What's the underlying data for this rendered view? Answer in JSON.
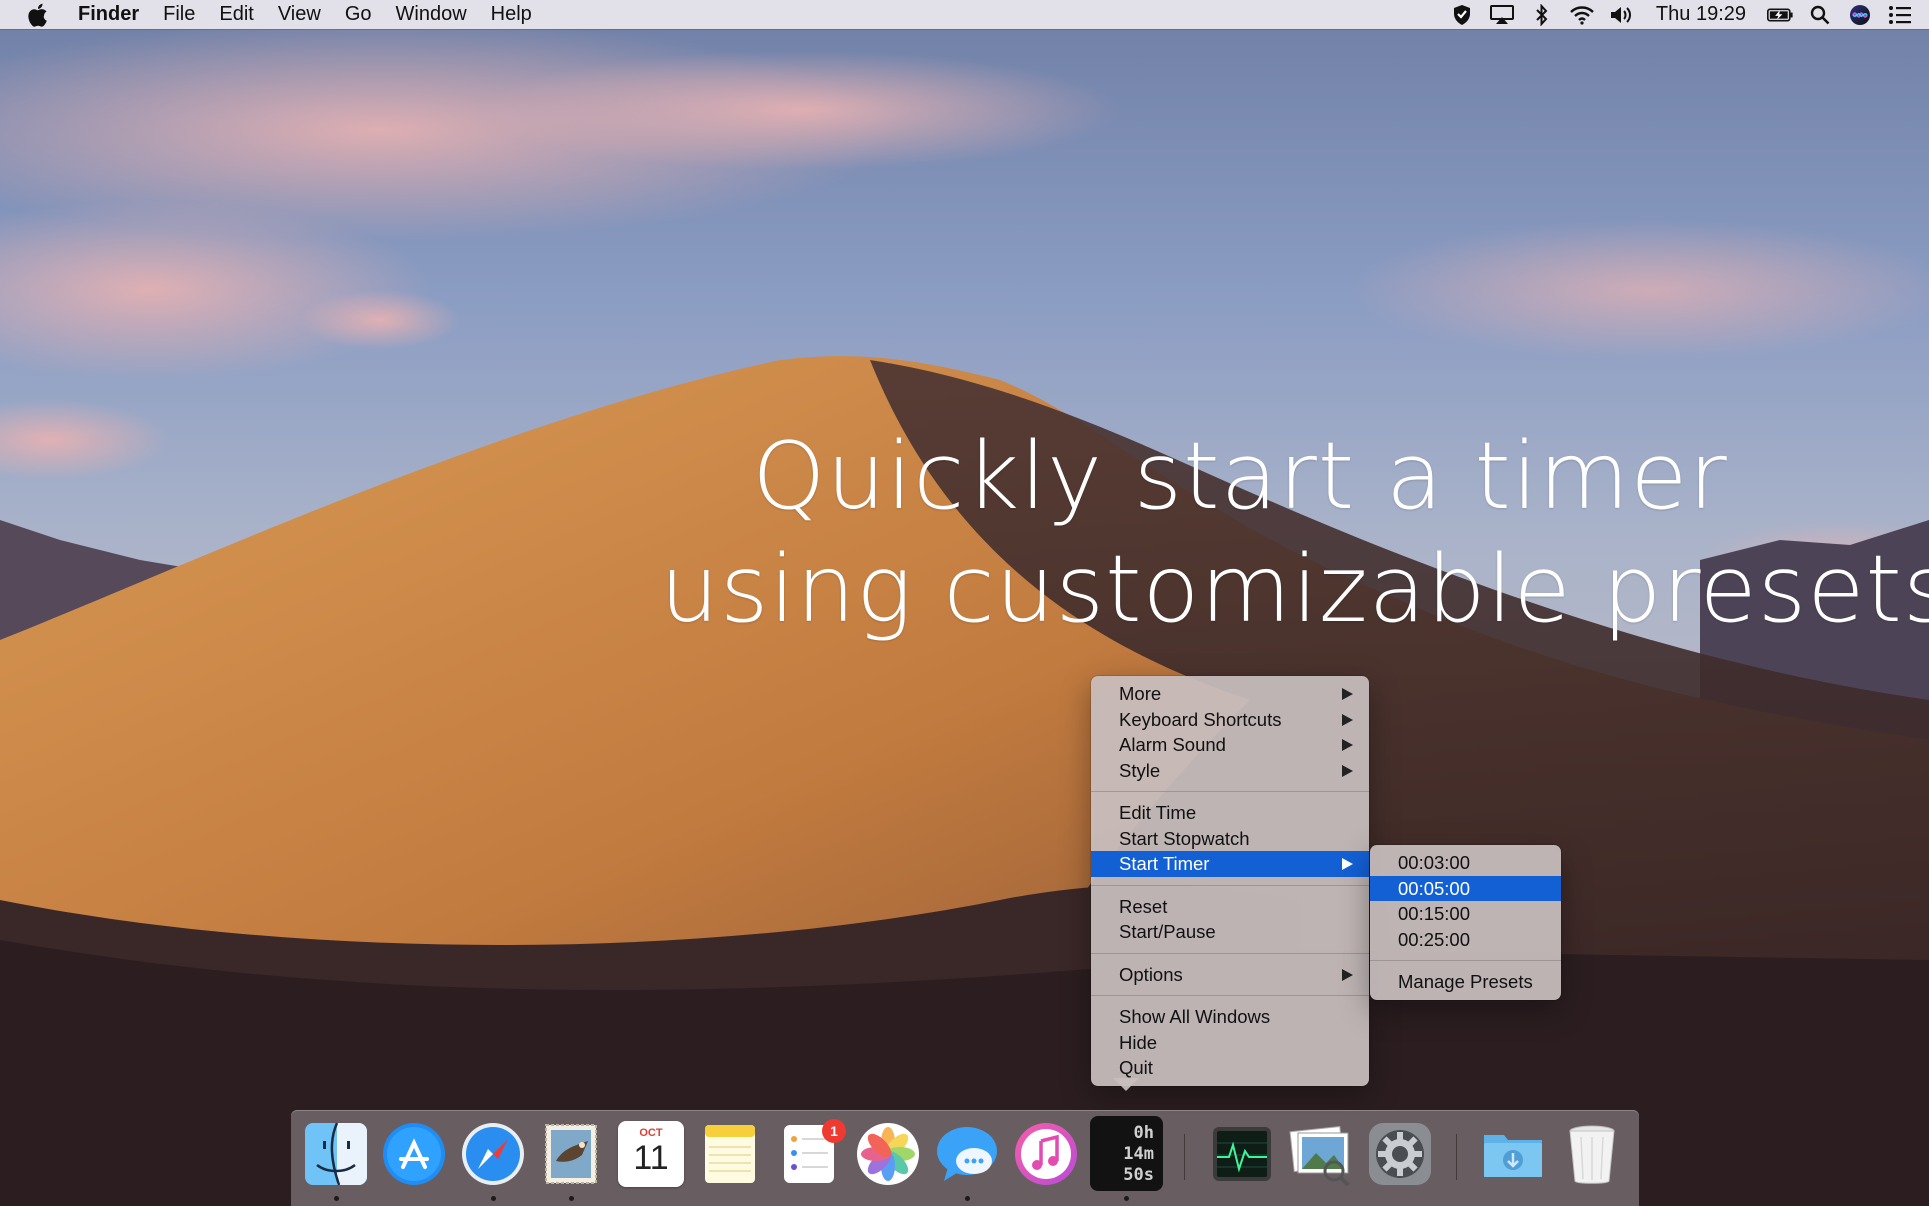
{
  "menubar": {
    "app_name": "Finder",
    "menus": [
      "File",
      "Edit",
      "View",
      "Go",
      "Window",
      "Help"
    ],
    "clock": "Thu 19:29"
  },
  "headline": {
    "line1": "Quickly start a timer",
    "line2": "using customizable presets"
  },
  "context_menu": {
    "group1": [
      "More",
      "Keyboard Shortcuts",
      "Alarm Sound",
      "Style"
    ],
    "group2": [
      "Edit Time",
      "Start Stopwatch",
      "Start Timer"
    ],
    "group3": [
      "Reset",
      "Start/Pause"
    ],
    "group4": [
      "Options"
    ],
    "group5": [
      "Show All Windows",
      "Hide",
      "Quit"
    ],
    "selected": "Start Timer"
  },
  "submenu": {
    "presets": [
      "00:03:00",
      "00:05:00",
      "00:15:00",
      "00:25:00"
    ],
    "selected": "00:05:00",
    "manage": "Manage Presets"
  },
  "dock": {
    "calendar_month": "OCT",
    "calendar_day": "11",
    "reminders_badge": "1",
    "timer_hours": "0h",
    "timer_minutes": "14m",
    "timer_seconds": "50s"
  },
  "colors": {
    "selection": "#1360d4",
    "menu_bg": "#c8bebe",
    "badge": "#ef3a32"
  }
}
